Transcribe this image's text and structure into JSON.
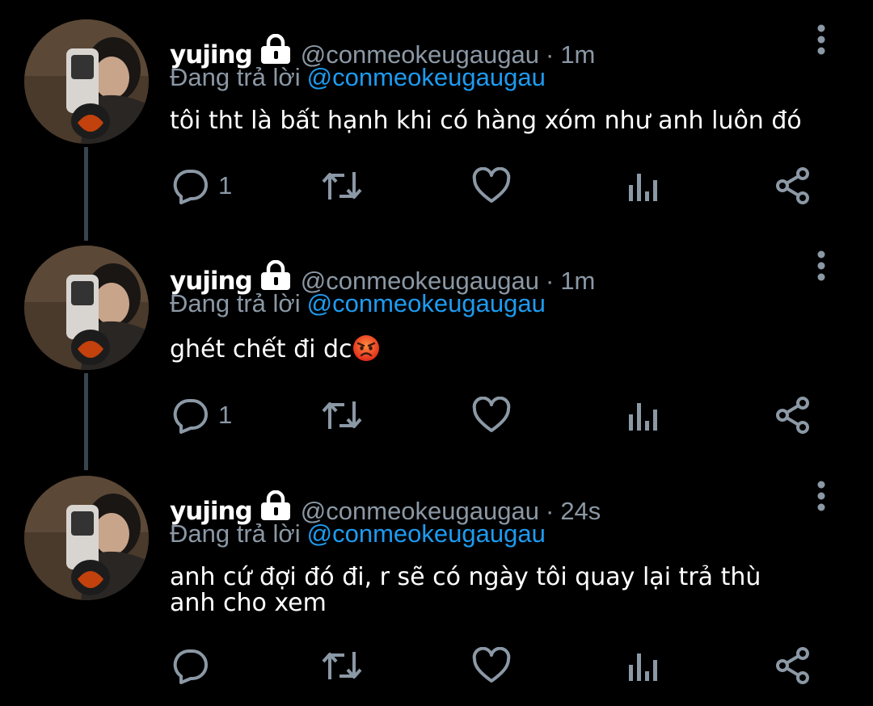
{
  "colors": {
    "background": "#000000",
    "text": "#ffffff",
    "secondary": "#8b98a5",
    "link": "#1d9bf0",
    "thread_line": "#38444d"
  },
  "tweets": [
    {
      "display_name": "yujing",
      "handle": "@conmeokeugaugau",
      "separator": "·",
      "time": "1m",
      "reply_prefix": "Đang trả lời",
      "reply_to": "@conmeokeugaugau",
      "text": "tôi tht là bất hạnh khi có hàng xóm như anh luôn đó",
      "emoji": "",
      "reply_count": "1",
      "icons": [
        "lock-icon",
        "more-vertical-icon",
        "reply-icon",
        "retweet-icon",
        "like-icon",
        "analytics-icon",
        "share-icon"
      ]
    },
    {
      "display_name": "yujing",
      "handle": "@conmeokeugaugau",
      "separator": "·",
      "time": "1m",
      "reply_prefix": "Đang trả lời",
      "reply_to": "@conmeokeugaugau",
      "text": "ghét chết đi dc",
      "emoji": "angry-face-emoji",
      "reply_count": "1",
      "icons": [
        "lock-icon",
        "more-vertical-icon",
        "reply-icon",
        "retweet-icon",
        "like-icon",
        "analytics-icon",
        "share-icon"
      ]
    },
    {
      "display_name": "yujing",
      "handle": "@conmeokeugaugau",
      "separator": "·",
      "time": "24s",
      "reply_prefix": "Đang trả lời",
      "reply_to": "@conmeokeugaugau",
      "text": "anh cứ đợi đó đi, r sẽ có ngày tôi quay lại trả thù anh cho xem",
      "emoji": "",
      "reply_count": "",
      "icons": [
        "lock-icon",
        "more-vertical-icon",
        "reply-icon",
        "retweet-icon",
        "like-icon",
        "analytics-icon",
        "share-icon"
      ]
    }
  ]
}
